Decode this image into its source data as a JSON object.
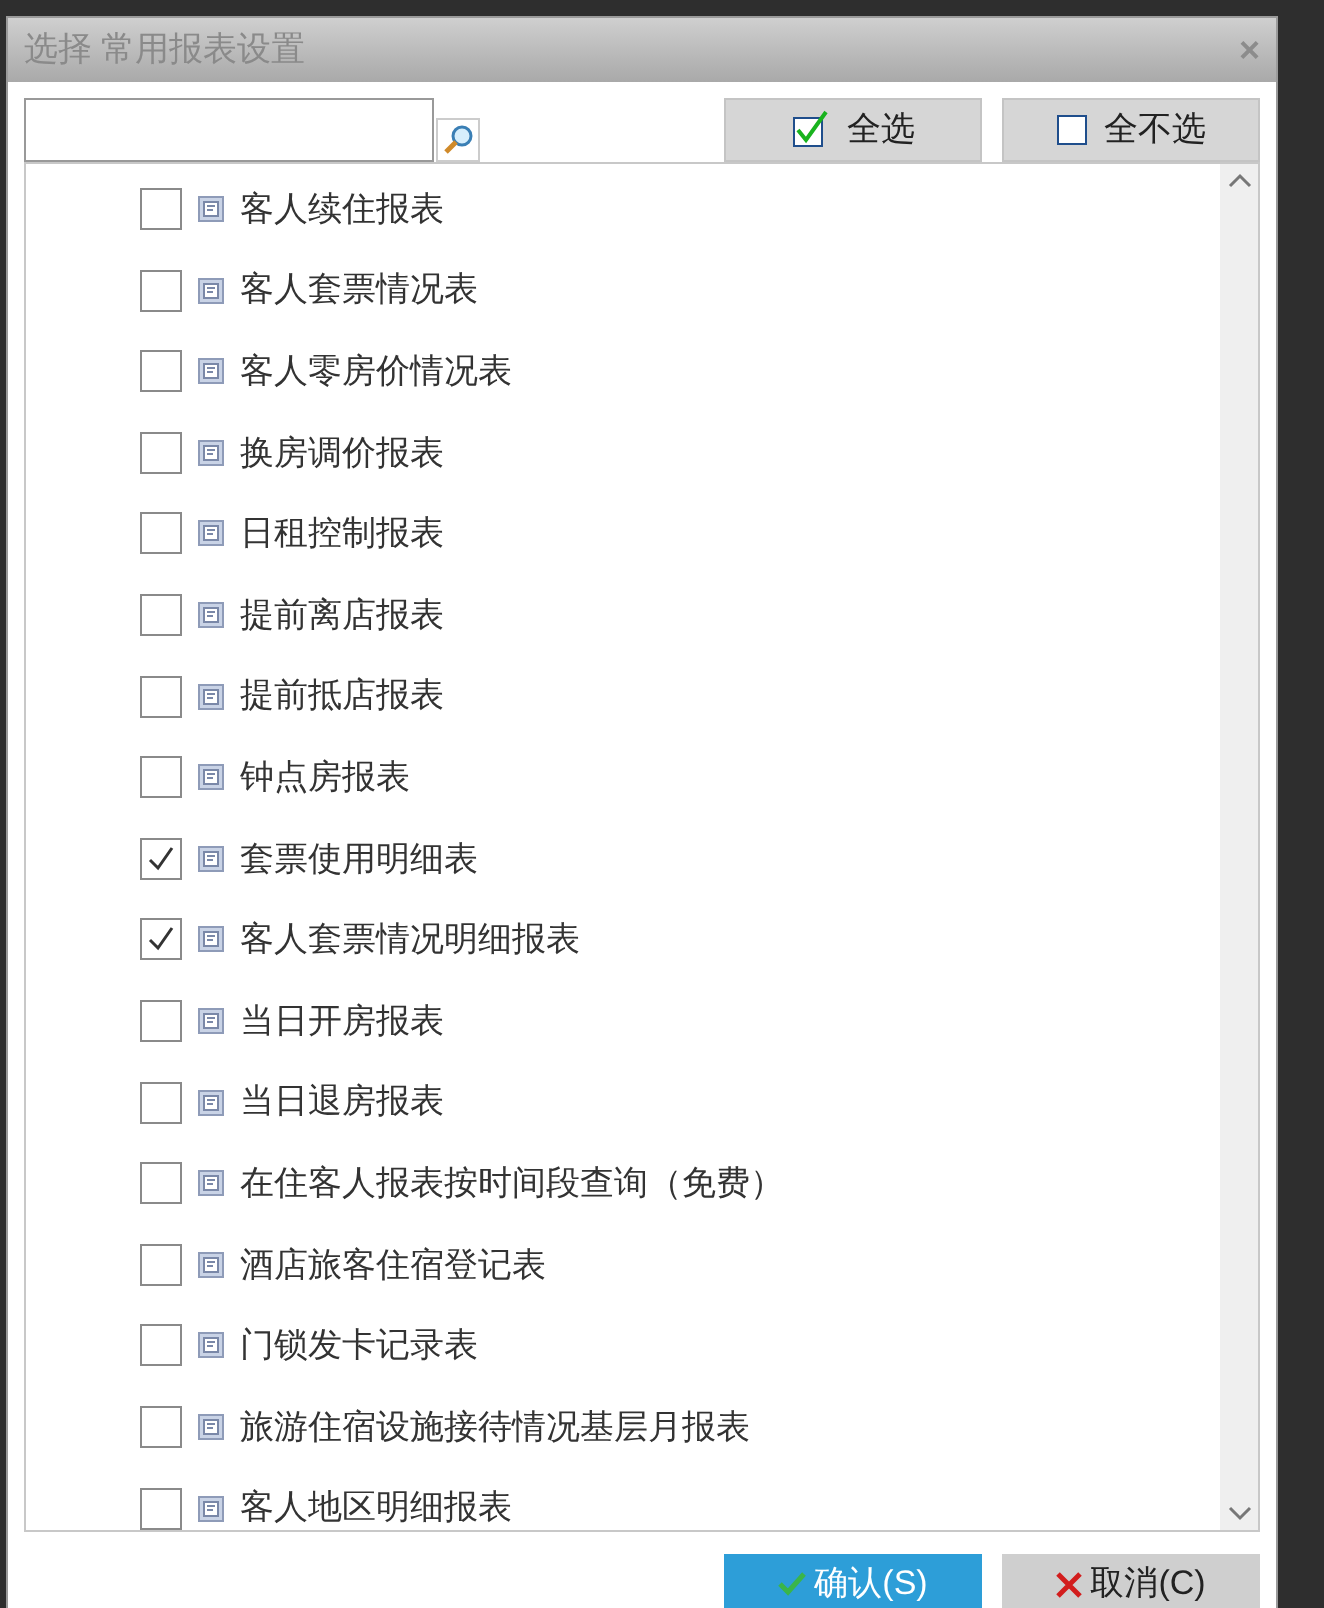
{
  "window": {
    "title": "选择 常用报表设置",
    "close": "×"
  },
  "select_all": {
    "label": "全选"
  },
  "select_none": {
    "label": "全不选"
  },
  "reports": [
    {
      "name": "客人续住报表",
      "checked": false
    },
    {
      "name": "客人套票情况表",
      "checked": false
    },
    {
      "name": "客人零房价情况表",
      "checked": false
    },
    {
      "name": "换房调价报表",
      "checked": false
    },
    {
      "name": "日租控制报表",
      "checked": false
    },
    {
      "name": "提前离店报表",
      "checked": false
    },
    {
      "name": "提前抵店报表",
      "checked": false
    },
    {
      "name": "钟点房报表",
      "checked": false
    },
    {
      "name": "套票使用明细表",
      "checked": true
    },
    {
      "name": "客人套票情况明细报表",
      "checked": true
    },
    {
      "name": "当日开房报表",
      "checked": false
    },
    {
      "name": "当日退房报表",
      "checked": false
    },
    {
      "name": "在住客人报表按时间段查询（免费）",
      "checked": false
    },
    {
      "name": "酒店旅客住宿登记表",
      "checked": false
    },
    {
      "name": "门锁发卡记录表",
      "checked": false
    },
    {
      "name": "旅游住宿设施接待情况基层月报表",
      "checked": false
    },
    {
      "name": "客人地区明细报表",
      "checked": false
    }
  ],
  "buttons": [
    {
      "label": "确认(S)",
      "kind": "confirm"
    },
    {
      "label": "取消(C)",
      "kind": "cancel"
    }
  ]
}
